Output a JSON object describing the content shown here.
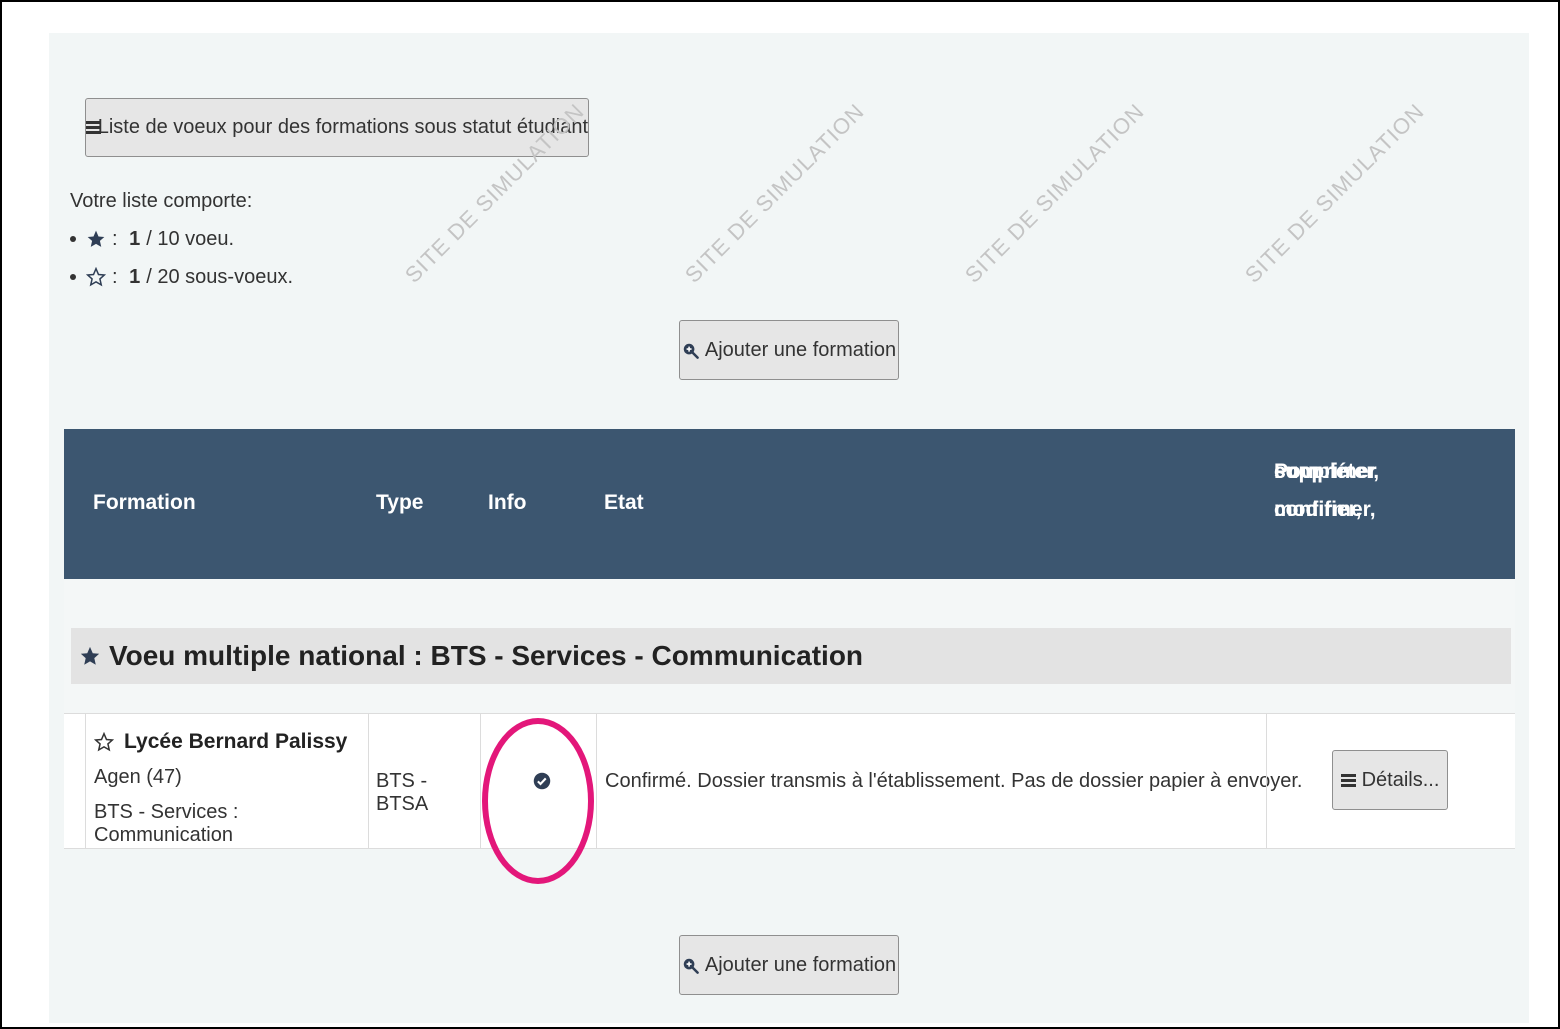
{
  "list_button": {
    "label": "Liste de voeux pour des formations sous statut étudiant",
    "icon": "list-icon"
  },
  "summary": {
    "title": "Votre liste comporte:",
    "voeux": {
      "icon": "star-filled-icon",
      "count": "1",
      "suffix": "/ 10 voeu."
    },
    "sous_voeux": {
      "icon": "star-outline-icon",
      "count": "1",
      "suffix": "/ 20 sous-voeux."
    }
  },
  "add_button": {
    "label": "Ajouter une formation",
    "icon": "zoom-in-icon"
  },
  "table": {
    "headers": {
      "formation": "Formation",
      "type": "Type",
      "info": "Info",
      "etat": "Etat",
      "actions": [
        "Pour modifier,",
        "compléter, confirmer,",
        "supprimer"
      ]
    },
    "group": {
      "icon": "star-filled-icon",
      "title": "Voeu multiple national : BTS - Services - Communication"
    },
    "rows": [
      {
        "etablissement": "Lycée Bernard Palissy",
        "lieu": "Agen (47)",
        "formation": "BTS - Services : Communication",
        "type": "BTS - BTSA",
        "info_icon": "check-circle-icon",
        "etat": "Confirmé. Dossier transmis à l'établissement. Pas de dossier papier à envoyer.",
        "details_label": "Détails..."
      }
    ]
  },
  "watermark": "SITE DE SIMULATION",
  "colors": {
    "header_bg": "#3c5670",
    "panel_bg": "#f2f6f6",
    "highlight": "#e3177a",
    "group_bg": "#e3e3e3"
  }
}
